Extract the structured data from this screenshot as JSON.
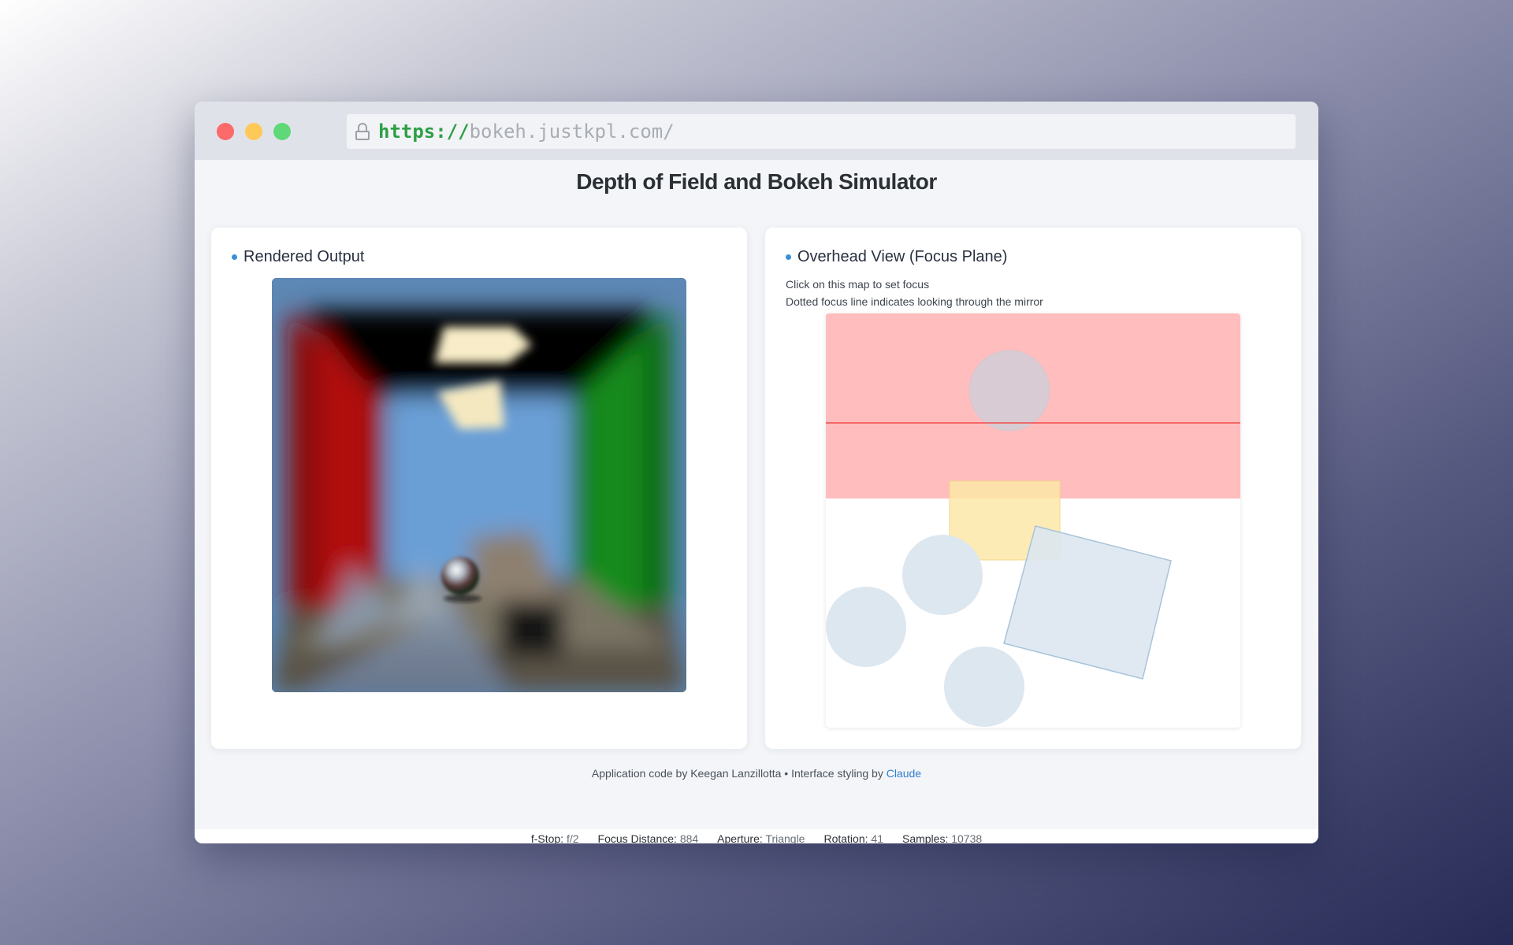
{
  "browser": {
    "url_protocol": "https://",
    "url_host": "bokeh.justkpl.com/"
  },
  "page": {
    "title": "Depth of Field and Bokeh Simulator"
  },
  "rendered_panel": {
    "heading": "Rendered Output"
  },
  "overhead_panel": {
    "heading": "Overhead View (Focus Plane)",
    "hint_1": "Click on this map to set focus",
    "hint_2": "Dotted focus line indicates looking through the mirror"
  },
  "footer": {
    "credit_prefix": "Application code by Keegan Lanzillotta • Interface styling by ",
    "credit_link": "Claude"
  },
  "status": {
    "fstop_label": "f-Stop:",
    "fstop_value": "f/2",
    "focus_label": "Focus Distance:",
    "focus_value": "884",
    "aperture_label": "Aperture:",
    "aperture_value": "Triangle",
    "rotation_label": "Rotation:",
    "rotation_value": "41",
    "samples_label": "Samples:",
    "samples_value": "10738"
  },
  "colors": {
    "accent": "#3b8fd6",
    "focus_zone": "#ffbdbd",
    "focus_line": "#ef4b4b",
    "object_fill": "#dde7f0",
    "light_object": "#fde7a8"
  }
}
